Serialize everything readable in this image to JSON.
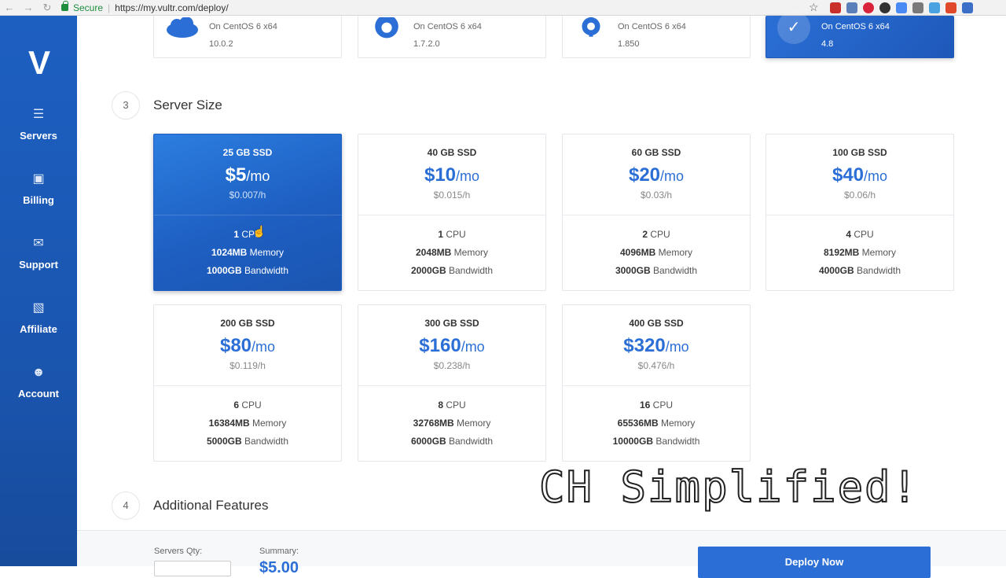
{
  "browser": {
    "secure_label": "Secure",
    "url": "https://my.vultr.com/deploy/"
  },
  "sidebar": {
    "items": [
      {
        "label": "Servers",
        "icon": "servers-icon"
      },
      {
        "label": "Billing",
        "icon": "billing-icon"
      },
      {
        "label": "Support",
        "icon": "support-icon"
      },
      {
        "label": "Affiliate",
        "icon": "affiliate-icon"
      },
      {
        "label": "Account",
        "icon": "account-icon"
      }
    ]
  },
  "apps": [
    {
      "os": "On CentOS 6 x64",
      "version": "10.0.2",
      "icon": "cloud-icon"
    },
    {
      "os": "On CentOS 6 x64",
      "version": "1.7.2.0",
      "icon": "ghost-icon"
    },
    {
      "os": "On CentOS 6 x64",
      "version": "1.850",
      "icon": "gear-icon"
    },
    {
      "os": "On CentOS 6 x64",
      "version": "4.8",
      "icon": "check-icon",
      "selected": true
    }
  ],
  "steps": {
    "server_size": {
      "num": "3",
      "title": "Server Size"
    },
    "additional": {
      "num": "4",
      "title": "Additional Features"
    }
  },
  "plans": [
    {
      "size": "25 GB SSD",
      "price": "$5",
      "per": "/mo",
      "hourly": "$0.007/h",
      "cpu_n": "1",
      "cpu_l": "CPU",
      "mem_n": "1024MB",
      "mem_l": "Memory",
      "bw_n": "1000GB",
      "bw_l": "Bandwidth",
      "active": true
    },
    {
      "size": "40 GB SSD",
      "price": "$10",
      "per": "/mo",
      "hourly": "$0.015/h",
      "cpu_n": "1",
      "cpu_l": "CPU",
      "mem_n": "2048MB",
      "mem_l": "Memory",
      "bw_n": "2000GB",
      "bw_l": "Bandwidth"
    },
    {
      "size": "60 GB SSD",
      "price": "$20",
      "per": "/mo",
      "hourly": "$0.03/h",
      "cpu_n": "2",
      "cpu_l": "CPU",
      "mem_n": "4096MB",
      "mem_l": "Memory",
      "bw_n": "3000GB",
      "bw_l": "Bandwidth"
    },
    {
      "size": "100 GB SSD",
      "price": "$40",
      "per": "/mo",
      "hourly": "$0.06/h",
      "cpu_n": "4",
      "cpu_l": "CPU",
      "mem_n": "8192MB",
      "mem_l": "Memory",
      "bw_n": "4000GB",
      "bw_l": "Bandwidth"
    },
    {
      "size": "200 GB SSD",
      "price": "$80",
      "per": "/mo",
      "hourly": "$0.119/h",
      "cpu_n": "6",
      "cpu_l": "CPU",
      "mem_n": "16384MB",
      "mem_l": "Memory",
      "bw_n": "5000GB",
      "bw_l": "Bandwidth"
    },
    {
      "size": "300 GB SSD",
      "price": "$160",
      "per": "/mo",
      "hourly": "$0.238/h",
      "cpu_n": "8",
      "cpu_l": "CPU",
      "mem_n": "32768MB",
      "mem_l": "Memory",
      "bw_n": "6000GB",
      "bw_l": "Bandwidth"
    },
    {
      "size": "400 GB SSD",
      "price": "$320",
      "per": "/mo",
      "hourly": "$0.476/h",
      "cpu_n": "16",
      "cpu_l": "CPU",
      "mem_n": "65536MB",
      "mem_l": "Memory",
      "bw_n": "10000GB",
      "bw_l": "Bandwidth"
    }
  ],
  "watermark": "CH Simplified!",
  "bottom": {
    "qty_label": "Servers Qty:",
    "summary_label": "Summary:",
    "summary_value": "$5.00",
    "deploy_label": "Deploy Now"
  },
  "colors": {
    "brand": "#1d5fc1",
    "accent": "#2b6fd6",
    "secure": "#1e8e3e"
  }
}
